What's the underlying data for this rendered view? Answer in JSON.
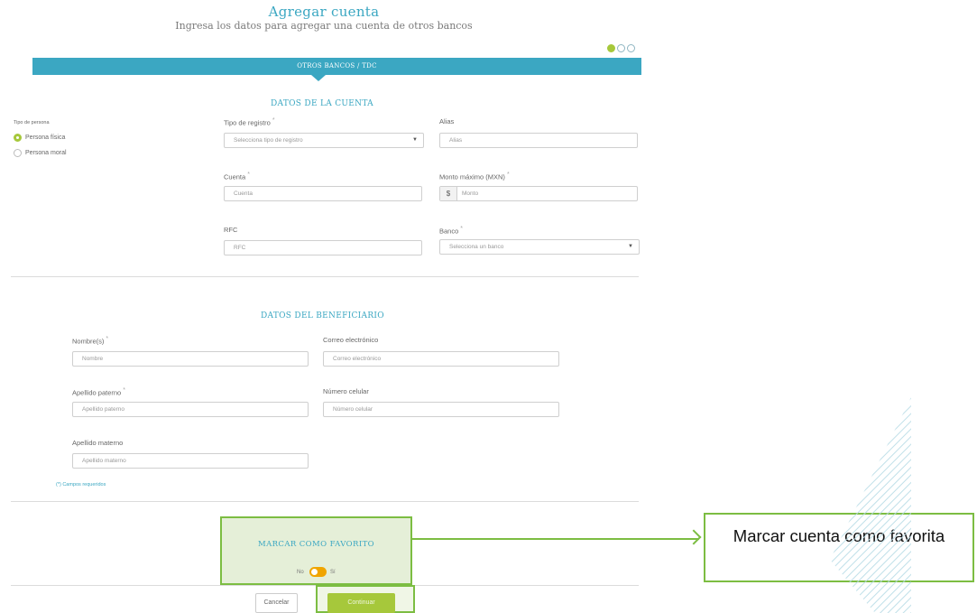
{
  "header": {
    "title": "Agregar cuenta",
    "subtitle": "Ingresa los datos para agregar una cuenta de otros bancos"
  },
  "steps": {
    "total": 3,
    "current": 1
  },
  "banner": {
    "label": "OTROS BANCOS / TDC"
  },
  "persona": {
    "label": "Tipo de persona",
    "options": [
      "Persona física",
      "Persona moral"
    ],
    "selected": "Persona física"
  },
  "cuenta": {
    "section_title": "DATOS DE LA CUENTA",
    "tipo_registro": {
      "label": "Tipo de registro",
      "value": "Selecciona tipo de registro"
    },
    "alias": {
      "label": "Alias",
      "placeholder": "Alias"
    },
    "cuenta": {
      "label": "Cuenta",
      "placeholder": "Cuenta"
    },
    "monto": {
      "label": "Monto máximo (MXN)",
      "currency": "$",
      "placeholder": "Monto"
    },
    "rfc": {
      "label": "RFC",
      "placeholder": "RFC"
    },
    "banco": {
      "label": "Banco",
      "value": "Selecciona un banco"
    },
    "required_mark": "*"
  },
  "beneficiario": {
    "section_title": "DATOS DEL BENEFICIARIO",
    "nombre": {
      "label": "Nombre(s)",
      "placeholder": "Nombre"
    },
    "correo": {
      "label": "Correo electrónico",
      "placeholder": "Correo electrónico"
    },
    "paterno": {
      "label": "Apellido paterno",
      "placeholder": "Apellido paterno"
    },
    "celular": {
      "label": "Número celular",
      "placeholder": "Número celular"
    },
    "materno": {
      "label": "Apellido materno",
      "placeholder": "Apellido materno"
    },
    "required_note": "(*) Campos requeridos"
  },
  "favorito": {
    "title": "MARCAR COMO FAVORITO",
    "off_label": "No",
    "on_label": "Sí",
    "state": "No"
  },
  "actions": {
    "cancel": "Cancelar",
    "continue": "Continuar"
  },
  "callout": {
    "text": "Marcar cuenta como favorita"
  },
  "colors": {
    "accent_blue": "#3ba7c2",
    "accent_green": "#a6c83b",
    "highlight_green": "#7cbd42",
    "toggle_orange": "#f0a500"
  }
}
